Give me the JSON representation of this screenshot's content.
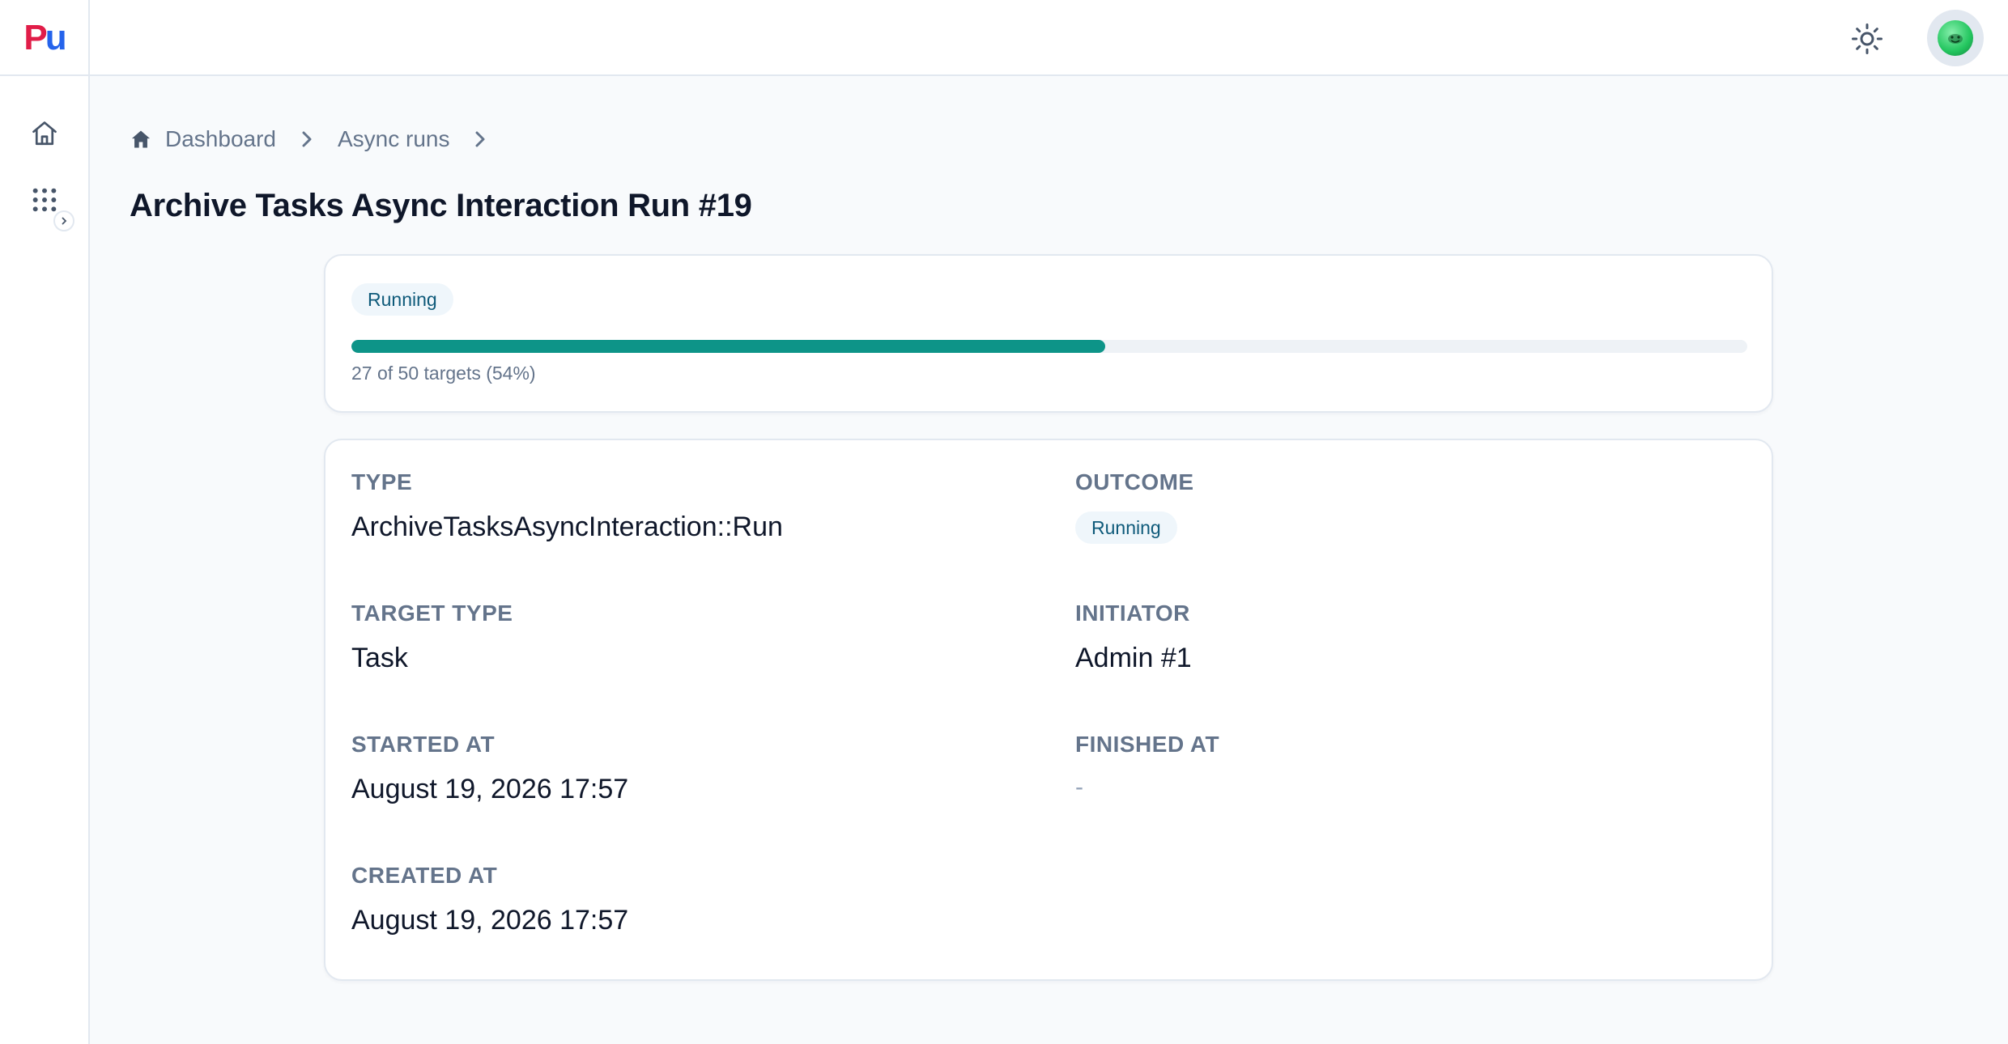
{
  "brand": {
    "logo_p": "P",
    "logo_u": "u"
  },
  "header": {
    "theme_icon": "sun-icon",
    "avatar_icon": "user-avatar"
  },
  "sidebar": {
    "items": [
      {
        "icon": "home-icon"
      },
      {
        "icon": "apps-grid-icon"
      }
    ],
    "expand_icon": "chevron-right-icon"
  },
  "breadcrumb": {
    "items": [
      {
        "label": "Dashboard",
        "icon": "home-icon"
      },
      {
        "label": "Async runs"
      }
    ]
  },
  "page": {
    "title": "Archive Tasks Async Interaction Run #19"
  },
  "progress": {
    "status": "Running",
    "completed": 27,
    "total": 50,
    "percent": 54,
    "text": "27 of 50 targets (54%)",
    "color": "#0d9488"
  },
  "details": {
    "type": {
      "label": "TYPE",
      "value": "ArchiveTasksAsyncInteraction::Run"
    },
    "outcome": {
      "label": "OUTCOME",
      "value": "Running"
    },
    "target_type": {
      "label": "TARGET TYPE",
      "value": "Task"
    },
    "initiator": {
      "label": "INITIATOR",
      "value": "Admin #1"
    },
    "started_at": {
      "label": "STARTED AT",
      "value": "August 19, 2026 17:57"
    },
    "finished_at": {
      "label": "FINISHED AT",
      "value": "-"
    },
    "created_at": {
      "label": "CREATED AT",
      "value": "August 19, 2026 17:57"
    }
  }
}
